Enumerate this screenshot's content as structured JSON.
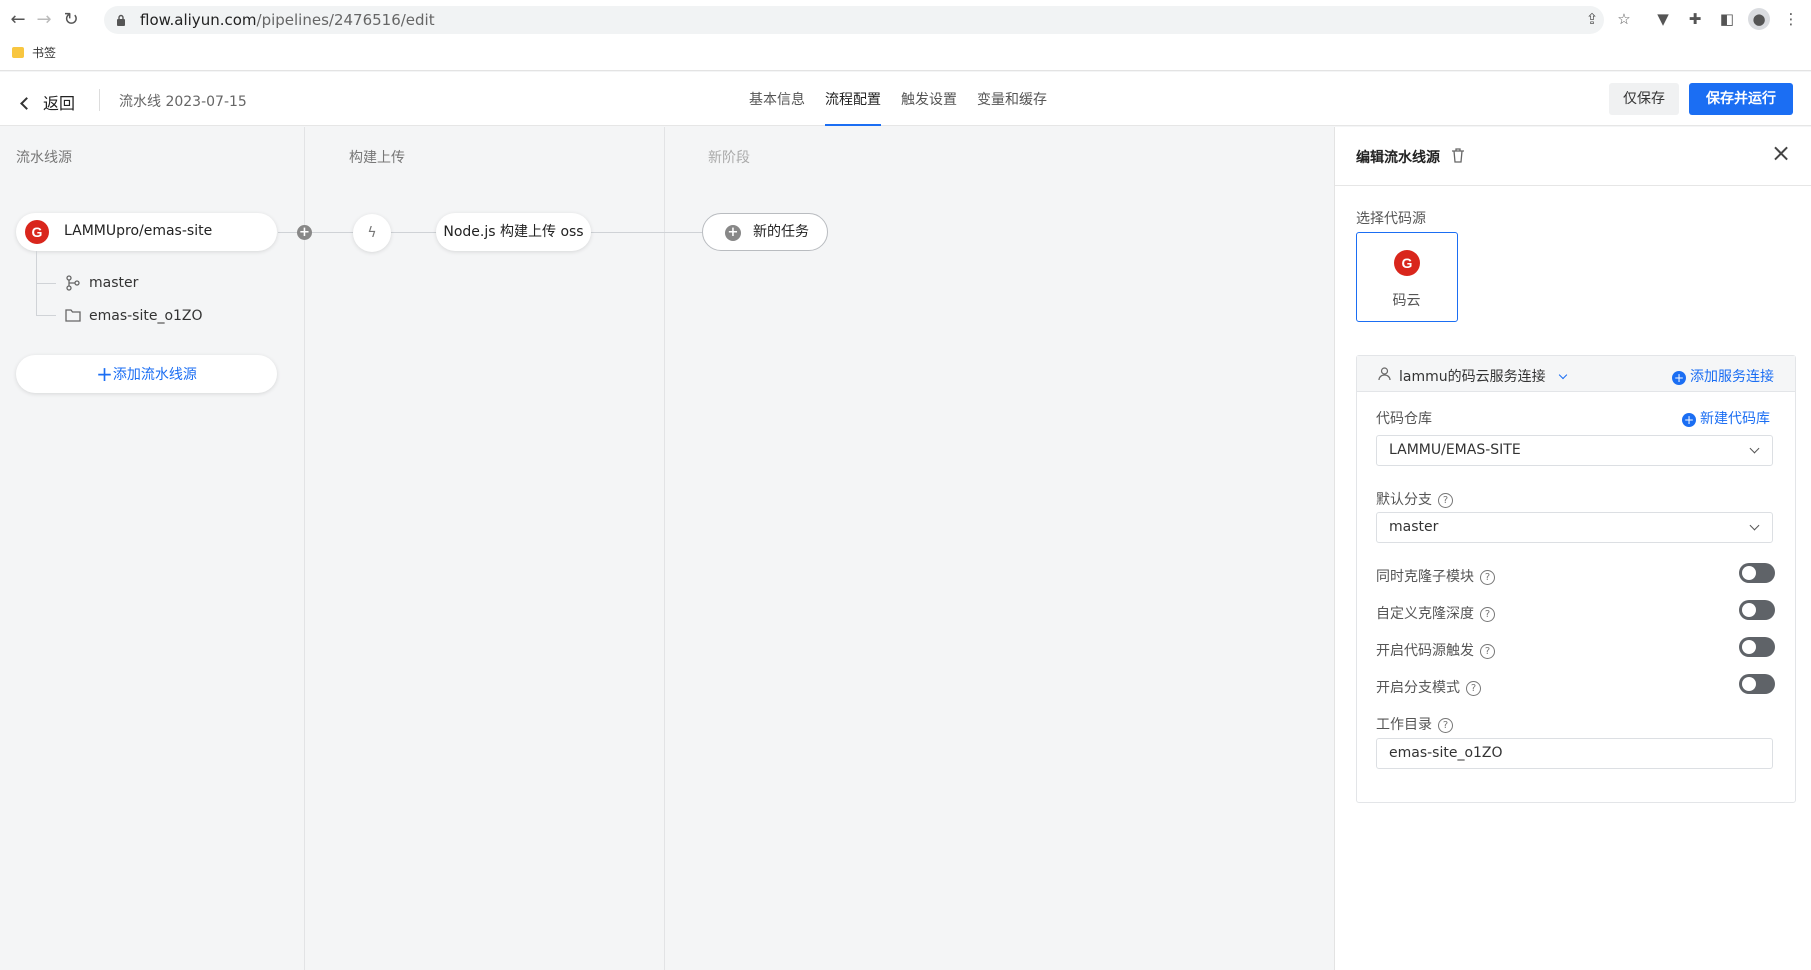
{
  "browser": {
    "url_host": "flow.aliyun.com",
    "url_path": "/pipelines/2476516/edit",
    "bookmark_folder": "书签"
  },
  "header": {
    "back_label": "返回",
    "pipeline_name": "流水线 2023-07-15",
    "tabs": [
      {
        "label": "基本信息",
        "active": false
      },
      {
        "label": "流程配置",
        "active": true
      },
      {
        "label": "触发设置",
        "active": false
      },
      {
        "label": "变量和缓存",
        "active": false
      }
    ],
    "save_only_label": "仅保存",
    "save_run_label": "保存并运行"
  },
  "canvas": {
    "columns": [
      {
        "title": "流水线源"
      },
      {
        "title": "构建上传"
      },
      {
        "title": "新阶段"
      }
    ],
    "source": {
      "repo": "LAMMUpro/emas-site",
      "branch": "master",
      "directory": "emas-site_o1ZO",
      "add_source_label": "添加流水线源"
    },
    "task": {
      "label": "Node.js 构建上传 oss"
    },
    "new_task_label": "新的任务"
  },
  "panel": {
    "title": "编辑流水线源",
    "code_source_label": "选择代码源",
    "selected_provider": "码云",
    "service_connection": "lammu的码云服务连接",
    "add_service_connection": "添加服务连接",
    "repo_label": "代码仓库",
    "new_repo_label": "新建代码库",
    "repo_value": "LAMMU/EMAS-SITE",
    "branch_label": "默认分支",
    "branch_value": "master",
    "toggles": [
      {
        "label": "同时克隆子模块",
        "on": false
      },
      {
        "label": "自定义克隆深度",
        "on": false
      },
      {
        "label": "开启代码源触发",
        "on": false
      },
      {
        "label": "开启分支模式",
        "on": false
      }
    ],
    "workdir_label": "工作目录",
    "workdir_value": "emas-site_o1ZO"
  },
  "colors": {
    "accent": "#1b6ef3",
    "gitee": "#d9261c"
  }
}
